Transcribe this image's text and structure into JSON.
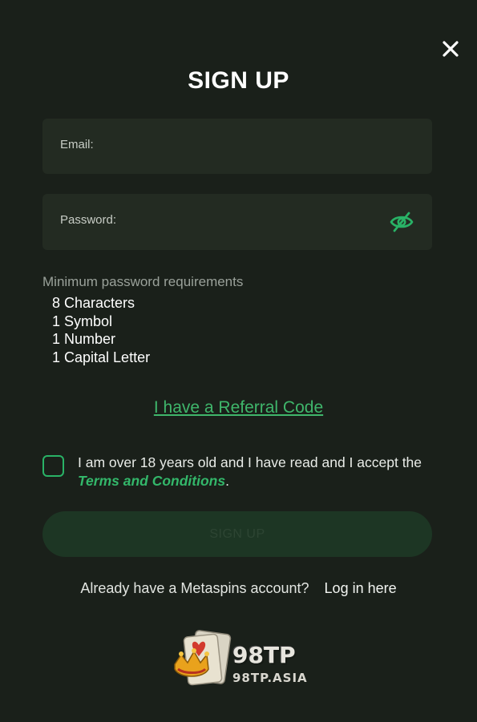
{
  "modal": {
    "title": "SIGN UP",
    "close_icon": "close-icon"
  },
  "form": {
    "email": {
      "label": "Email:",
      "value": ""
    },
    "password": {
      "label": "Password:",
      "value": "",
      "toggle_icon": "eye-off-icon"
    }
  },
  "requirements": {
    "title": "Minimum password requirements",
    "items": [
      "8 Characters",
      "1 Symbol",
      "1 Number",
      "1 Capital Letter"
    ]
  },
  "referral": {
    "label": "I have a Referral Code"
  },
  "consent": {
    "checked": false,
    "text_before": "I am over 18 years old and I have read and I accept the ",
    "link_text": "Terms and Conditions",
    "text_after": "."
  },
  "signup_button": {
    "label": "SIGN UP"
  },
  "login": {
    "prompt": "Already have a Metaspins account?",
    "link": "Log in here"
  },
  "logo": {
    "brand": "98TP",
    "domain": "98TP.ASIA"
  },
  "colors": {
    "background": "#1a201a",
    "field": "#232b22",
    "accent": "#33b76a",
    "button_disabled": "#1d3624"
  }
}
